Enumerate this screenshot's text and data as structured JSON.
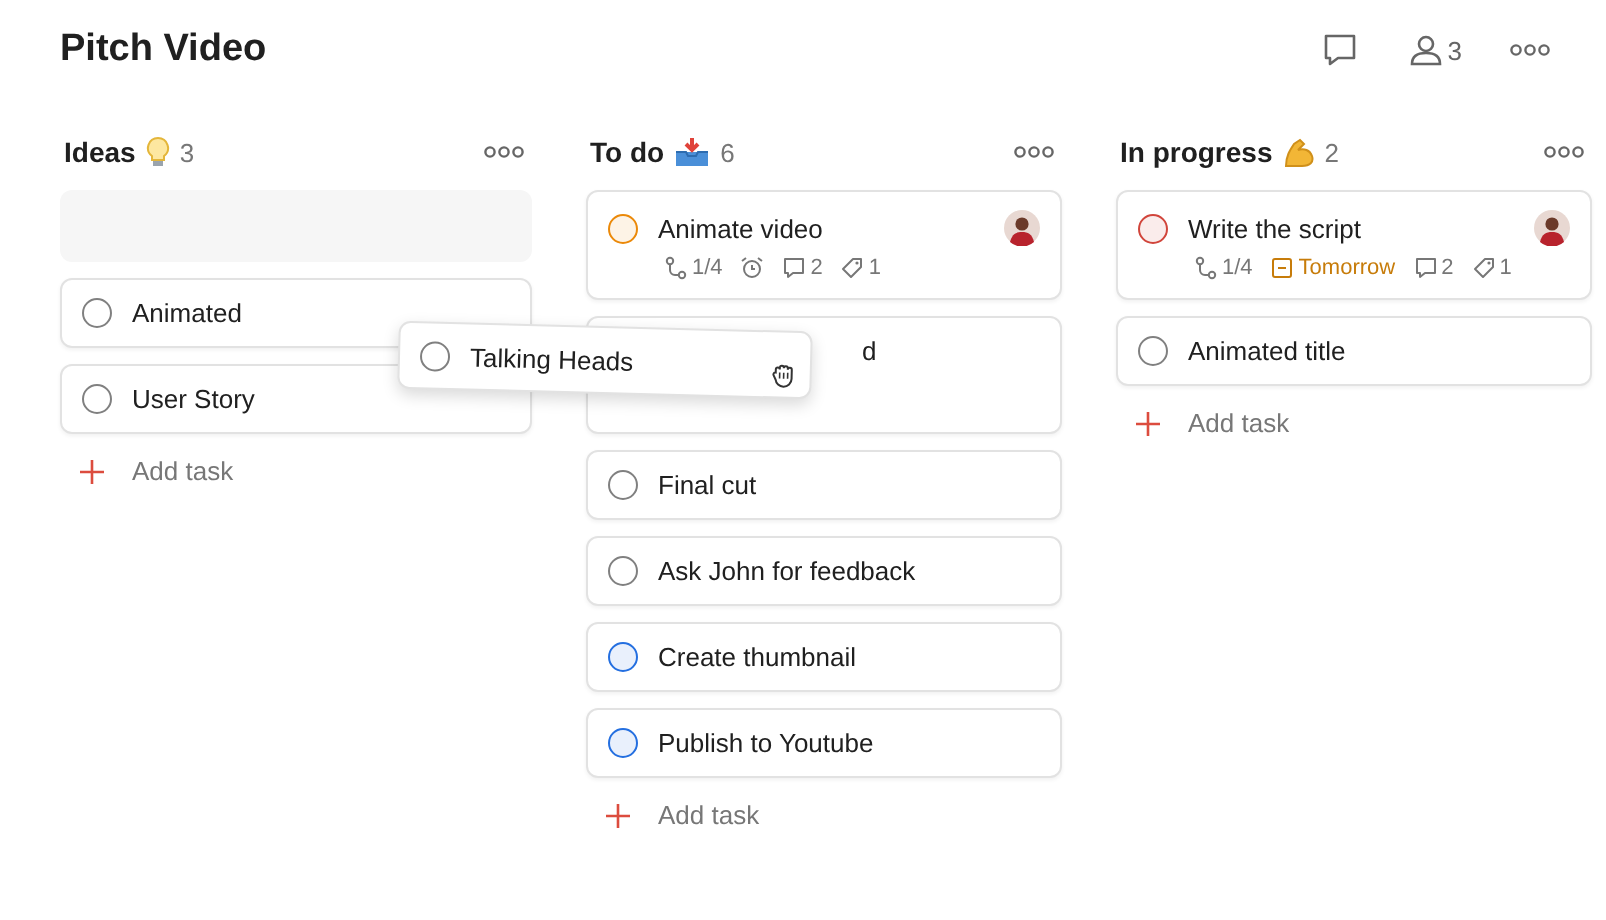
{
  "title": "Pitch Video",
  "header": {
    "collaborators": "3"
  },
  "columns": [
    {
      "name": "Ideas",
      "count": "3",
      "drop_placeholder": true,
      "cards": [
        {
          "kind": "task",
          "title": "Animated",
          "color": "#808080",
          "avatar": false
        },
        {
          "kind": "task",
          "title": "User Story",
          "color": "#808080",
          "avatar": false
        }
      ],
      "add": "Add task"
    },
    {
      "name": "To do",
      "count": "6",
      "cards": [
        {
          "kind": "task",
          "title": "Animate video",
          "color": "#eb8909",
          "avatar": true,
          "meta": [
            {
              "kind": "subtasks",
              "text": "1/4"
            },
            {
              "kind": "reminder"
            },
            {
              "kind": "comments",
              "text": "2"
            },
            {
              "kind": "labels",
              "text": "1"
            }
          ]
        },
        {
          "kind": "covered",
          "title": "d"
        },
        {
          "kind": "task",
          "title": "Final cut",
          "color": "#808080",
          "avatar": false
        },
        {
          "kind": "task",
          "title": "Ask John for feedback",
          "color": "#808080",
          "avatar": false
        },
        {
          "kind": "task",
          "title": "Create thumbnail",
          "color": "#246fe0",
          "avatar": false
        },
        {
          "kind": "task",
          "title": "Publish to Youtube",
          "color": "#246fe0",
          "avatar": false
        }
      ],
      "add": "Add task"
    },
    {
      "name": "In progress",
      "count": "2",
      "cards": [
        {
          "kind": "task",
          "title": "Write the script",
          "color": "#d1453b",
          "avatar": true,
          "meta": [
            {
              "kind": "subtasks",
              "text": "1/4"
            },
            {
              "kind": "due",
              "text": "Tomorrow"
            },
            {
              "kind": "comments",
              "text": "2"
            },
            {
              "kind": "labels",
              "text": "1"
            }
          ]
        },
        {
          "kind": "task",
          "title": "Animated title",
          "color": "#808080",
          "avatar": false
        }
      ],
      "add": "Add task"
    }
  ],
  "dragged": {
    "title": "Talking Heads",
    "color": "#808080"
  }
}
